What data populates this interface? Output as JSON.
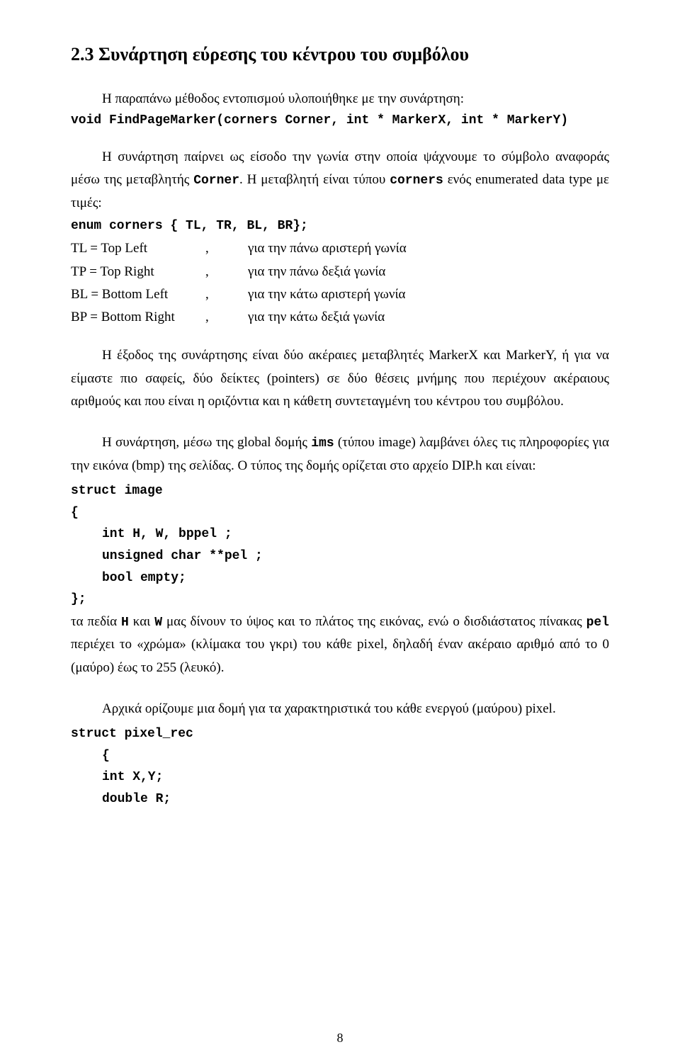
{
  "section": {
    "title": "2.3 Συνάρτηση εύρεσης του κέντρου του συμβόλου"
  },
  "p1_lead": "Η παραπάνω μέθοδος εντοπισμού υλοποιήθηκε με την συνάρτηση:",
  "fn_decl": "void  FindPageMarker(corners Corner, int * MarkerX, int * MarkerY)",
  "p2_a": "Η συνάρτηση παίρνει ως είσοδο την γωνία στην οποία ψάχνουμε το σύμβολο αναφοράς μέσω της μεταβλητής ",
  "p2_var1": "Corner",
  "p2_b": ". Η μεταβλητή είναι τύπου ",
  "p2_var2": "corners",
  "p2_c": " ενός enumerated data type με τιμές:",
  "enum_decl": "enum corners { TL, TR, BL, BR};",
  "defs": [
    {
      "l": "TL = Top Left",
      "r": "για την πάνω αριστερή γωνία"
    },
    {
      "l": "TP = Top Right",
      "r": "για την πάνω δεξιά γωνία"
    },
    {
      "l": "BL = Bottom Left",
      "r": "για την κάτω αριστερή γωνία"
    },
    {
      "l": "BP = Bottom Right",
      "r": "για την κάτω δεξιά γωνία"
    }
  ],
  "comma": ",",
  "p3": "Η έξοδος της συνάρτησης είναι δύο ακέραιες μεταβλητές MarkerX και MarkerY, ή για να είμαστε πιο σαφείς, δύο δείκτες (pointers) σε δύο θέσεις μνήμης που περιέχουν ακέραιους αριθμούς και που είναι η οριζόντια και η κάθετη συντεταγμένη του κέντρου του συμβόλου.",
  "p4_a": "Η συνάρτηση, μέσω της global δομής ",
  "p4_var1": "ims",
  "p4_b": " (τύπου image) λαμβάνει όλες τις πληροφορίες για την εικόνα (bmp) της σελίδας. Ο τύπος της δομής ορίζεται στο αρχείο DIP.h και είναι:",
  "struct1": {
    "l1": "struct image",
    "l2": "{",
    "l3": "int H, W, bppel ;",
    "l4": "unsigned char **pel ;",
    "l5": "bool empty;",
    "l6": "};"
  },
  "p5_a": "τα πεδία ",
  "p5_v1": "H",
  "p5_and": " και ",
  "p5_v2": "W",
  "p5_b": "  μας δίνουν το ύψος και το πλάτος της εικόνας, ενώ ο δισδιάστατος πίνακας ",
  "p5_v3": "pel",
  "p5_c": " περιέχει το «χρώμα» (κλίμακα του γκρι) του κάθε pixel, δηλαδή έναν ακέραιο αριθμό από το 0 (μαύρο) έως το 255 (λευκό).",
  "p6": "Αρχικά ορίζουμε μια δομή για τα χαρακτηριστικά του κάθε ενεργού (μαύρου) pixel.",
  "struct2": {
    "l1": "struct pixel_rec",
    "l2": "{",
    "l3": "int X,Y;",
    "l4": "double R;"
  },
  "pagenum": "8"
}
